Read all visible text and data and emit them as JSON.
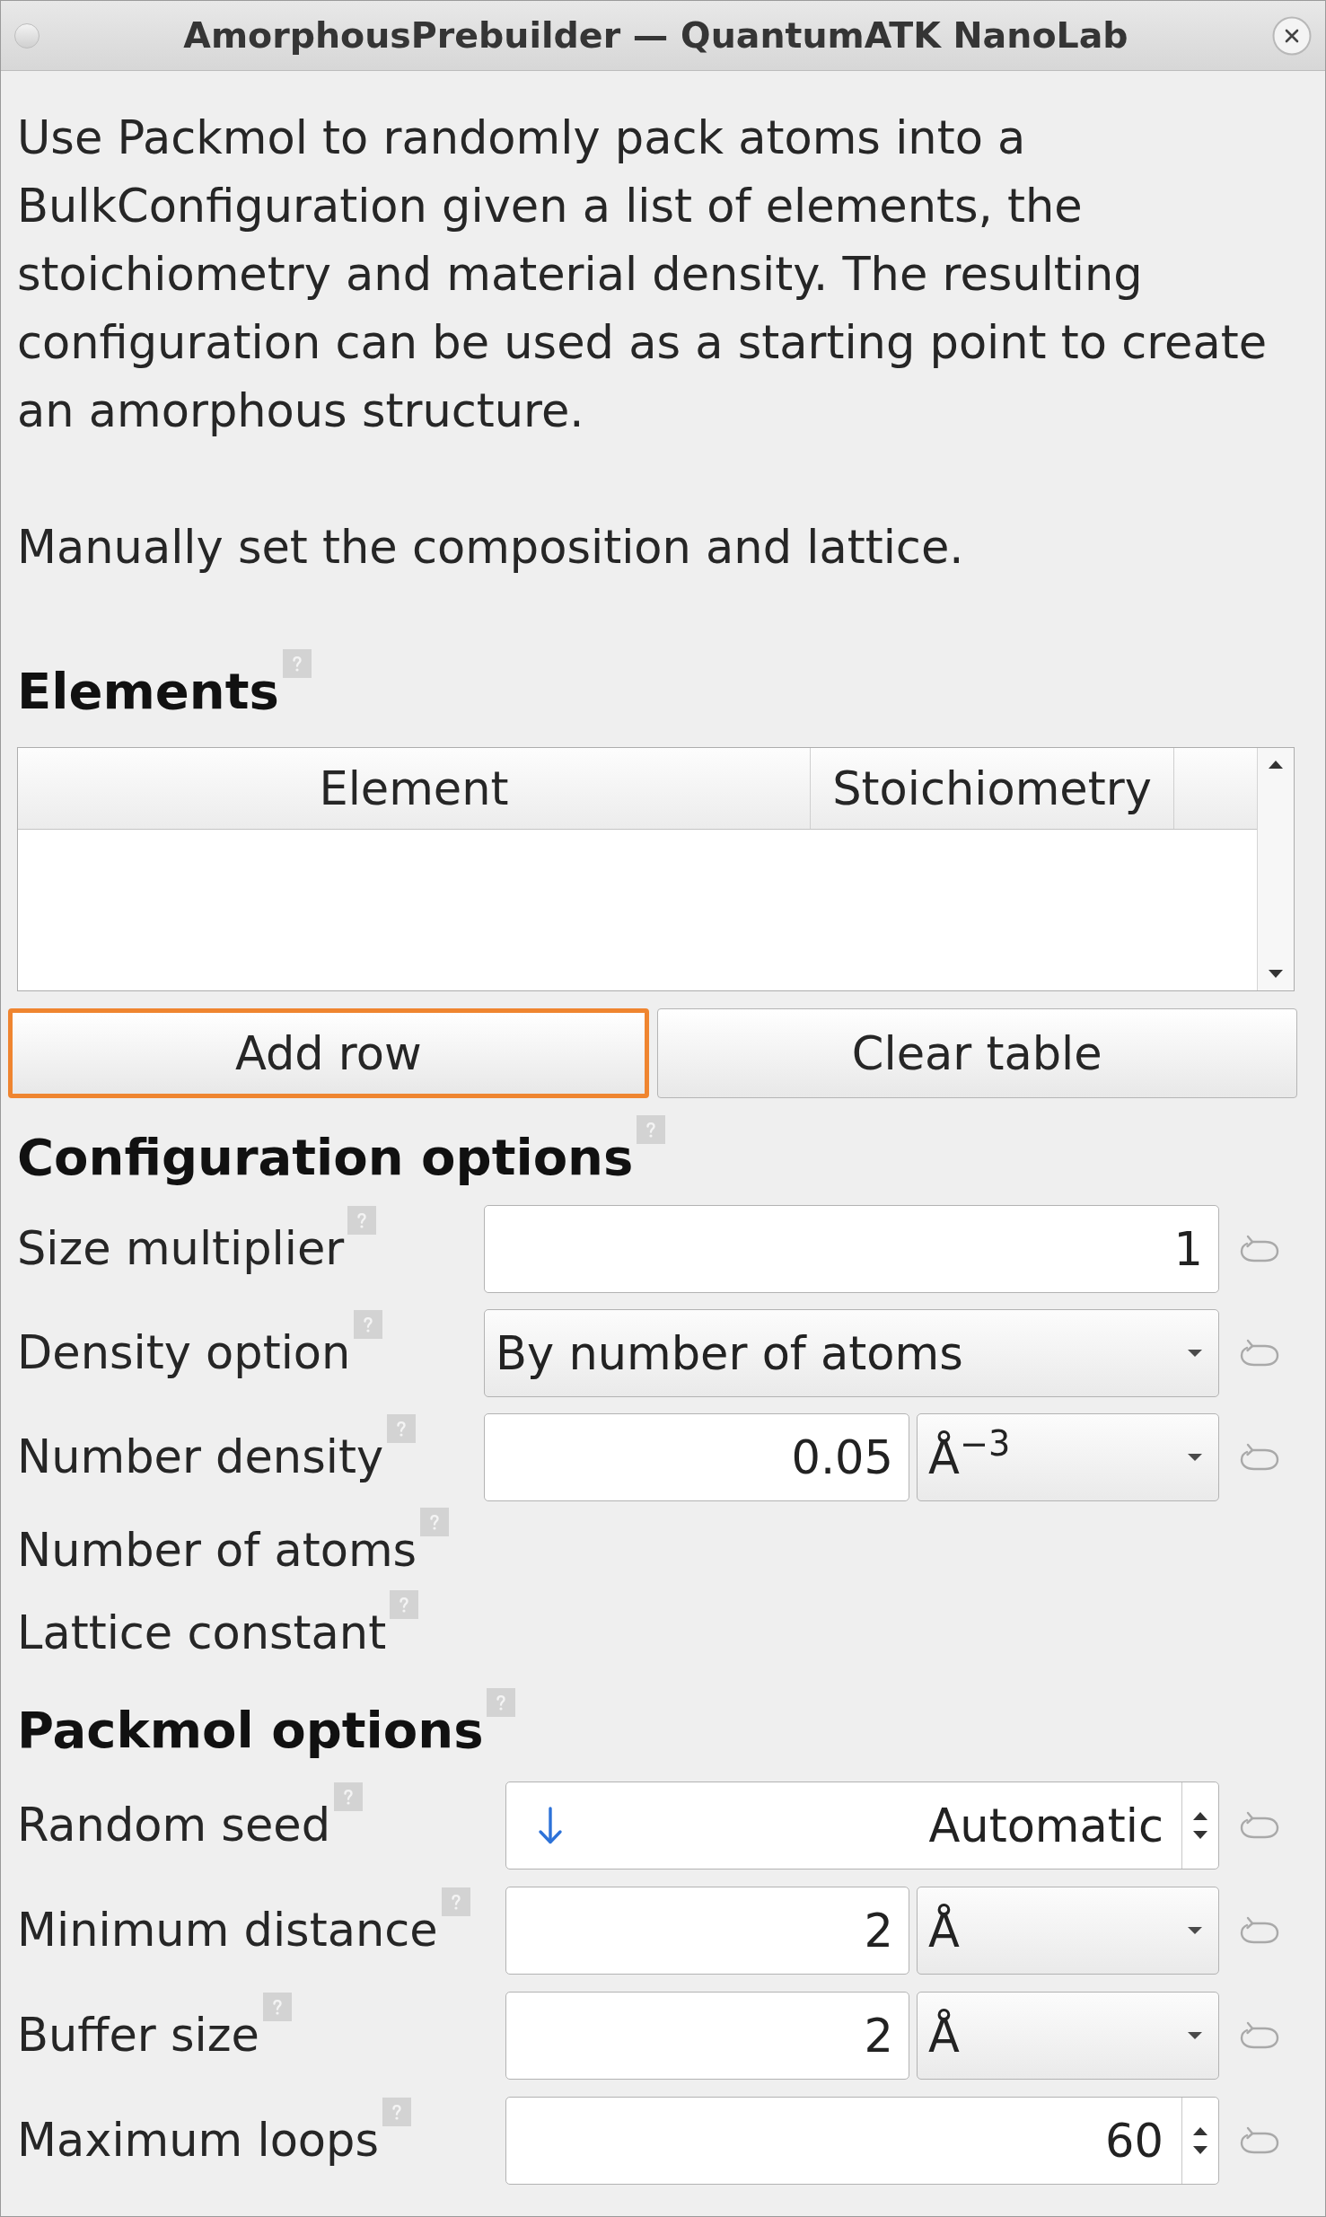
{
  "window": {
    "title": "AmorphousPrebuilder — QuantumATK NanoLab"
  },
  "description": [
    "Use Packmol to randomly pack atoms into a BulkConfiguration given a list of elements, the stoichiometry and material density. The resulting configuration can be used as a starting point to create an amorphous structure.",
    "Manually set the composition and lattice."
  ],
  "elements": {
    "title": "Elements",
    "table": {
      "columns": [
        "Element",
        "Stoichiometry"
      ]
    },
    "buttons": [
      {
        "label": "Add row",
        "highlighted": true
      },
      {
        "label": "Clear table",
        "highlighted": false
      }
    ]
  },
  "configuration_options": {
    "title": "Configuration options",
    "rows": [
      {
        "kind": "field",
        "label": "Size multiplier",
        "value": "1"
      },
      {
        "kind": "combo",
        "label": "Density option",
        "value": "By number of atoms"
      },
      {
        "kind": "field_unit",
        "label": "Number density",
        "value": "0.05",
        "unit": "Å$^{−3}$"
      },
      {
        "kind": "label",
        "label": "Number of atoms"
      },
      {
        "kind": "label",
        "label": "Lattice constant"
      }
    ]
  },
  "packmol_options": {
    "title": "Packmol options",
    "rows": [
      {
        "kind": "seed_spin",
        "label": "Random seed",
        "value": "Automatic"
      },
      {
        "kind": "field_unit",
        "label": "Minimum distance",
        "value": "2",
        "unit": "Å"
      },
      {
        "kind": "field_unit",
        "label": "Buffer size",
        "value": "2",
        "unit": "Å"
      },
      {
        "kind": "spin",
        "label": "Maximum loops",
        "value": "60"
      }
    ]
  }
}
